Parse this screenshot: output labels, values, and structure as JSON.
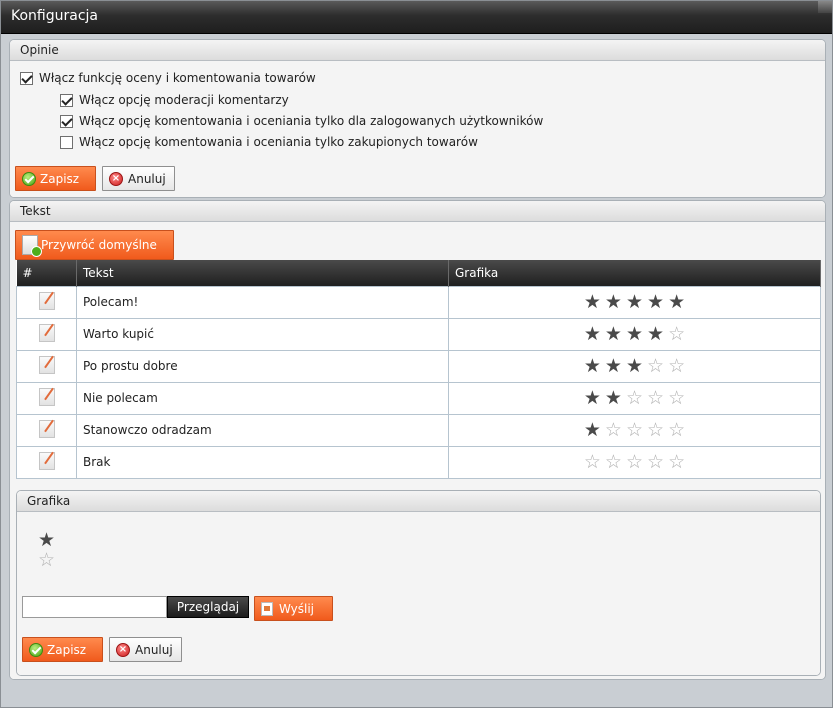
{
  "window": {
    "title": "Konfiguracja"
  },
  "opinie": {
    "header": "Opinie",
    "options": [
      {
        "label": "Włącz funkcję oceny i komentowania towarów",
        "checked": true
      },
      {
        "label": "Włącz opcję moderacji komentarzy",
        "checked": true
      },
      {
        "label": "Włącz opcję komentowania i oceniania tylko dla zalogowanych użytkowników",
        "checked": true
      },
      {
        "label": "Włącz opcję komentowania i oceniania tylko zakupionych towarów",
        "checked": false
      }
    ],
    "save_label": "Zapisz",
    "cancel_label": "Anuluj"
  },
  "tekst": {
    "header": "Tekst",
    "restore_label": "Przywróć domyślne",
    "columns": [
      "#",
      "Tekst",
      "Grafika"
    ],
    "rows": [
      {
        "text": "Polecam!",
        "stars": 5
      },
      {
        "text": "Warto kupić",
        "stars": 4
      },
      {
        "text": "Po prostu dobre",
        "stars": 3
      },
      {
        "text": "Nie polecam",
        "stars": 2
      },
      {
        "text": "Stanowczo odradzam",
        "stars": 1
      },
      {
        "text": "Brak",
        "stars": 0
      }
    ],
    "max_stars": 5
  },
  "grafika": {
    "header": "Grafika",
    "browse_label": "Przeglądaj",
    "send_label": "Wyślij",
    "save_label": "Zapisz",
    "cancel_label": "Anuluj"
  },
  "colors": {
    "accent": "#f26a2a",
    "header_dark": "#2a2a2a",
    "star_full": "#4a4a4a",
    "star_empty": "#b0b0b0"
  }
}
